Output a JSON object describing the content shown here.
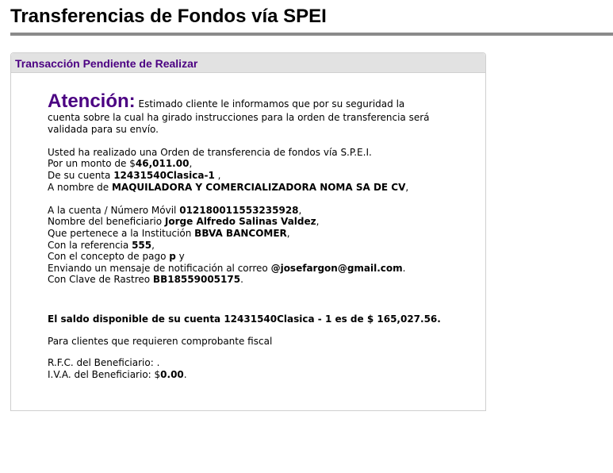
{
  "page": {
    "title": "Transferencias de Fondos vía SPEI"
  },
  "panel": {
    "title": "Transacción Pendiente de Realizar",
    "attention_label": "Atención:",
    "attention_text_1": "Estimado cliente le informamos que por su seguridad la",
    "attention_text_2": "cuenta sobre la cual ha girado instrucciones para la orden de transferencia será",
    "attention_text_3": "validada para su envío.",
    "order_intro": "Usted ha realizado una Orden de transferencia de fondos vía S.P.E.I.",
    "amount_prefix": "Por un monto de $",
    "amount_value": "46,011.00",
    "amount_suffix": ",",
    "source_prefix": "De su cuenta ",
    "source_value": "12431540Clasica-1",
    "source_suffix": " ,",
    "holder_prefix": "A nombre de ",
    "holder_value": "MAQUILADORA Y COMERCIALIZADORA NOMA SA DE CV",
    "holder_suffix": ",",
    "dest_prefix": "A la cuenta / Número Móvil ",
    "dest_value": "012180011553235928",
    "dest_suffix": ",",
    "beneficiary_prefix": "Nombre del beneficiario ",
    "beneficiary_value": "Jorge Alfredo Salinas Valdez",
    "beneficiary_suffix": ",",
    "institution_prefix": "Que pertenece a la Institución ",
    "institution_value": "BBVA BANCOMER",
    "institution_suffix": ",",
    "reference_prefix": "Con la referencia ",
    "reference_value": "555",
    "reference_suffix": ",",
    "concept_prefix": "Con el concepto de pago ",
    "concept_value": "p",
    "concept_suffix": " y",
    "email_prefix": "Enviando un mensaje de notificación al correo ",
    "email_value": "@josefargon@gmail.com",
    "email_suffix": ".",
    "tracking_prefix": "Con Clave de Rastreo ",
    "tracking_value": "BB18559005175",
    "tracking_suffix": ".",
    "balance_text": "El saldo disponible de su cuenta 12431540Clasica - 1 es de $ 165,027.56.",
    "fiscal_text": "Para clientes que requieren comprobante fiscal",
    "rfc_text": "R.F.C. del Beneficiario: .",
    "iva_prefix": "I.V.A. del Beneficiario: $",
    "iva_value": "0.00",
    "iva_suffix": "."
  }
}
